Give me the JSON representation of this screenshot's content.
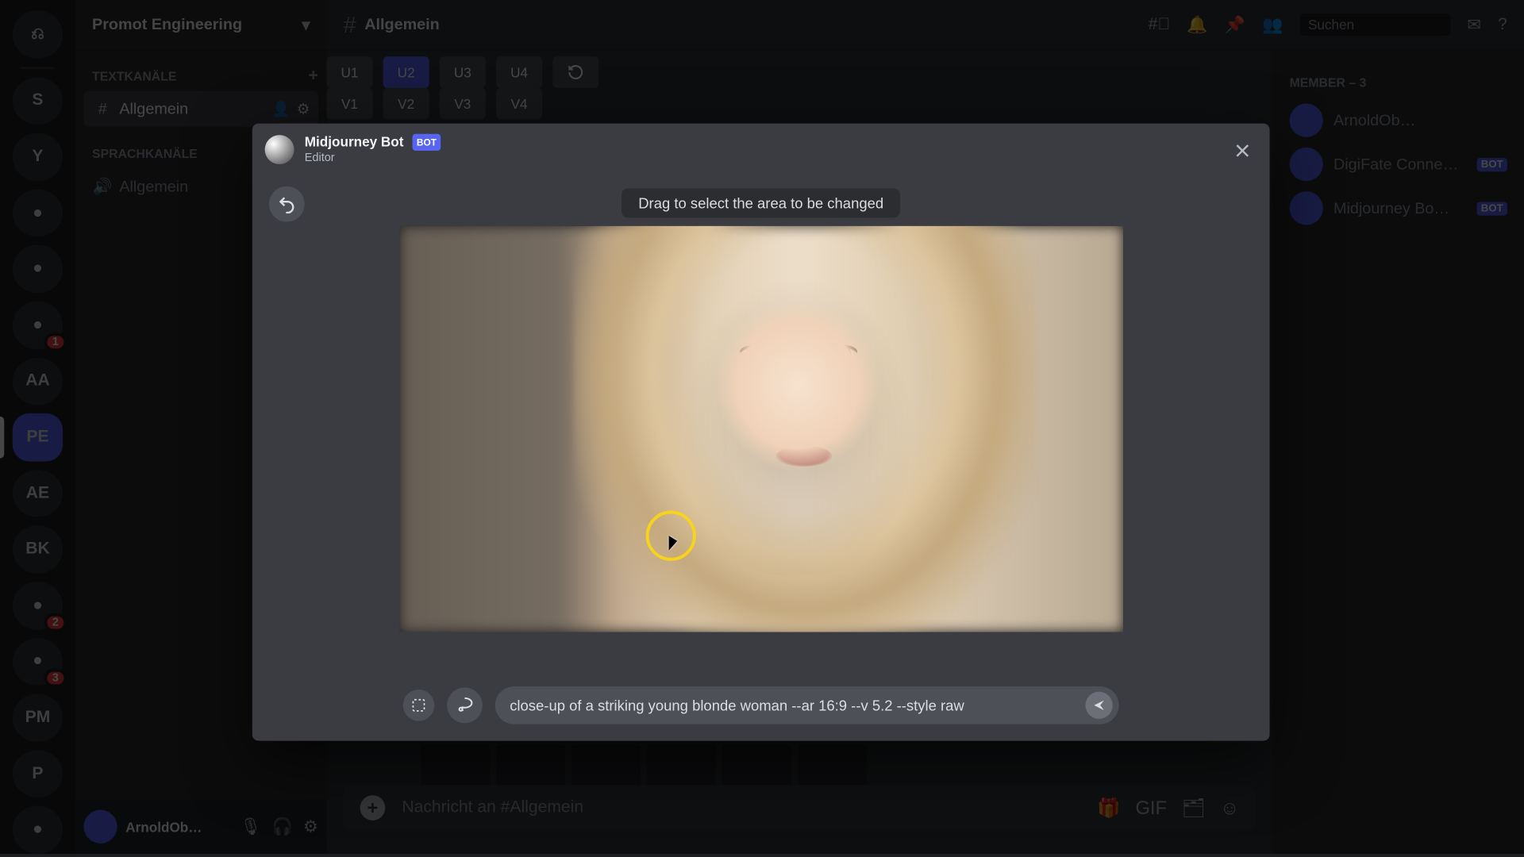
{
  "server": {
    "name": "Promot Engineering"
  },
  "categories": [
    {
      "label": "TEXTKANÄLE",
      "channels": [
        {
          "label": "Allgemein",
          "selected": true
        }
      ]
    },
    {
      "label": "SPRACHKANÄLE",
      "channels": [
        {
          "label": "Allgemein",
          "selected": false
        }
      ]
    }
  ],
  "channel_header": {
    "name": "Allgemein",
    "search_placeholder": "Suchen"
  },
  "upscale_row": {
    "u1": "U1",
    "u2": "U2",
    "u3": "U3",
    "u4": "U4"
  },
  "variant_row": {
    "v1": "V1",
    "v2": "V2",
    "v3": "V3",
    "v4": "V4"
  },
  "members_header": "MEMBER – 3",
  "members": [
    {
      "name": "ArnoldOb…",
      "bot": false
    },
    {
      "name": "DigiFate Conne…",
      "bot": true,
      "badge": "BOT"
    },
    {
      "name": "Midjourney Bo…",
      "bot": true,
      "badge": "BOT"
    }
  ],
  "chat_input_placeholder": "Nachricht an #Allgemein",
  "user_panel": {
    "name": "ArnoldOb…"
  },
  "modal": {
    "author": "Midjourney Bot",
    "author_badge": "BOT",
    "subtitle": "Editor",
    "hint": "Drag to select the area to be changed",
    "prompt": "close-up of a striking young blonde woman --ar 16:9 --v 5.2 --style raw"
  },
  "guilds": [
    {
      "label": "⎌",
      "kind": "discord"
    },
    {
      "label": "S"
    },
    {
      "label": "Y"
    },
    {
      "label": "●"
    },
    {
      "label": "●"
    },
    {
      "label": "●",
      "badge": "1"
    },
    {
      "label": "AA"
    },
    {
      "label": "PE",
      "selected": true
    },
    {
      "label": "AE"
    },
    {
      "label": "BK"
    },
    {
      "label": "●",
      "badge": "2"
    },
    {
      "label": "●",
      "badge": "3"
    },
    {
      "label": "PM"
    },
    {
      "label": "P"
    },
    {
      "label": "●"
    }
  ]
}
